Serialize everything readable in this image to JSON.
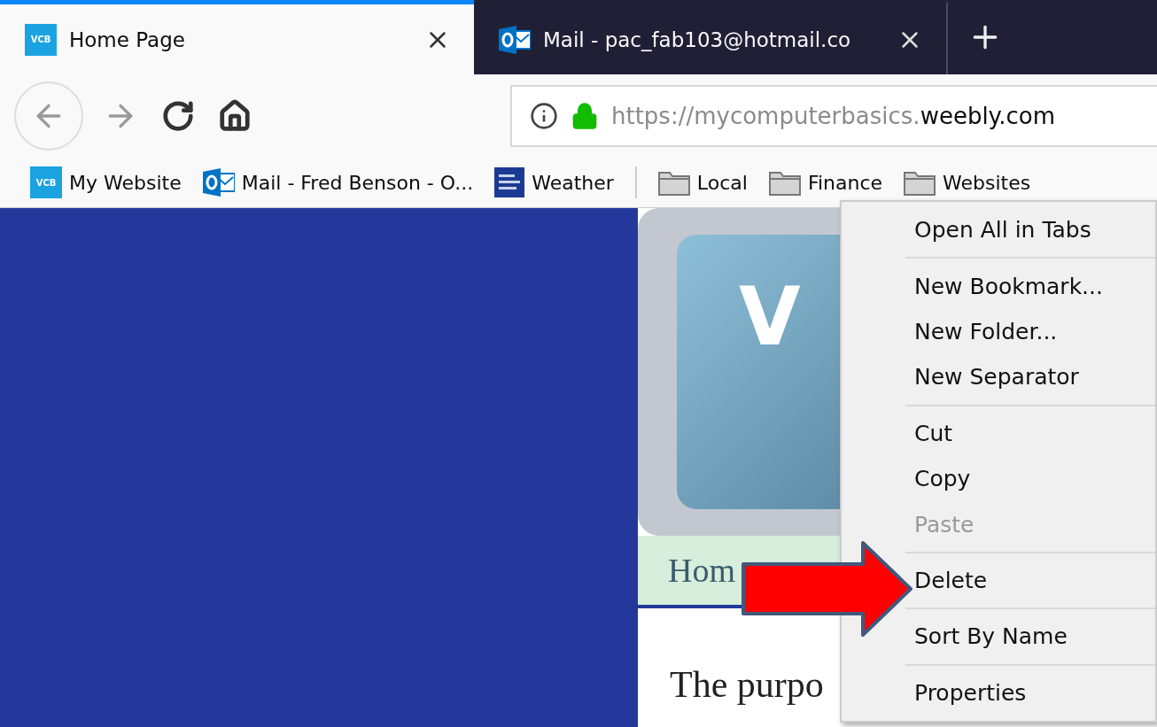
{
  "tabs": [
    {
      "kind": "vcb",
      "icon_text": "VCB",
      "title": "Home Page",
      "selected": true
    },
    {
      "kind": "outlook",
      "title": "Mail - pac_fab103@hotmail.co",
      "selected": false
    }
  ],
  "url": {
    "host_start": "https://mycomputerbasics.",
    "domain": "weebly.com"
  },
  "bookmarks": [
    {
      "kind": "vcb",
      "icon_text": "VCB",
      "label": "My Website"
    },
    {
      "kind": "outlook",
      "label": "Mail - Fred Benson - O..."
    },
    {
      "kind": "weather",
      "label": "Weather"
    },
    {
      "kind": "separator"
    },
    {
      "kind": "folder",
      "label": "Local"
    },
    {
      "kind": "folder",
      "label": "Finance"
    },
    {
      "kind": "folder",
      "label": "Websites"
    }
  ],
  "page": {
    "logo_letter": "V",
    "nav_link": "Hom",
    "intro": "The purpo"
  },
  "context_menu": [
    {
      "kind": "item",
      "label": "Open All in Tabs",
      "disabled": false
    },
    {
      "kind": "separator"
    },
    {
      "kind": "item",
      "label": "New Bookmark...",
      "disabled": false
    },
    {
      "kind": "item",
      "label": "New Folder...",
      "disabled": false
    },
    {
      "kind": "item",
      "label": "New Separator",
      "disabled": false
    },
    {
      "kind": "separator"
    },
    {
      "kind": "item",
      "label": "Cut",
      "disabled": false
    },
    {
      "kind": "item",
      "label": "Copy",
      "disabled": false
    },
    {
      "kind": "item",
      "label": "Paste",
      "disabled": true
    },
    {
      "kind": "separator"
    },
    {
      "kind": "item",
      "label": "Delete",
      "disabled": false
    },
    {
      "kind": "separator"
    },
    {
      "kind": "item",
      "label": "Sort By Name",
      "disabled": false
    },
    {
      "kind": "separator"
    },
    {
      "kind": "item",
      "label": "Properties",
      "disabled": false
    }
  ]
}
